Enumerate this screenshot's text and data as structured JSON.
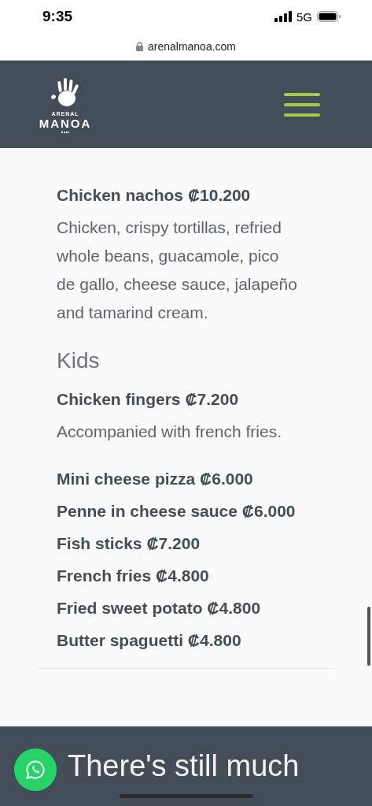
{
  "status_bar": {
    "time": "9:35",
    "network": "5G"
  },
  "address_bar": {
    "url": "arenalmanoa.com"
  },
  "header": {
    "logo_small": "ARENAL",
    "logo_large": "MANOA"
  },
  "sections": [
    {
      "items": [
        {
          "title": "Chicken nachos ₡10.200",
          "description": "Chicken, crispy tortillas, refried whole beans, guacamole, pico de gallo, cheese sauce, jalapeño and tamarind cream."
        }
      ]
    },
    {
      "heading": "Kids",
      "items": [
        {
          "title": "Chicken fingers ₡7.200",
          "description": "Accompanied with french fries."
        },
        {
          "title": "Mini cheese pizza ₡6.000"
        },
        {
          "title": "Penne in cheese sauce ₡6.000"
        },
        {
          "title": "Fish sticks ₡7.200"
        },
        {
          "title": "French fries ₡4.800"
        },
        {
          "title": "Fried sweet potato ₡4.800"
        },
        {
          "title": "Butter spaguetti ₡4.800"
        }
      ]
    }
  ],
  "footer": {
    "heading": "There's still much"
  }
}
